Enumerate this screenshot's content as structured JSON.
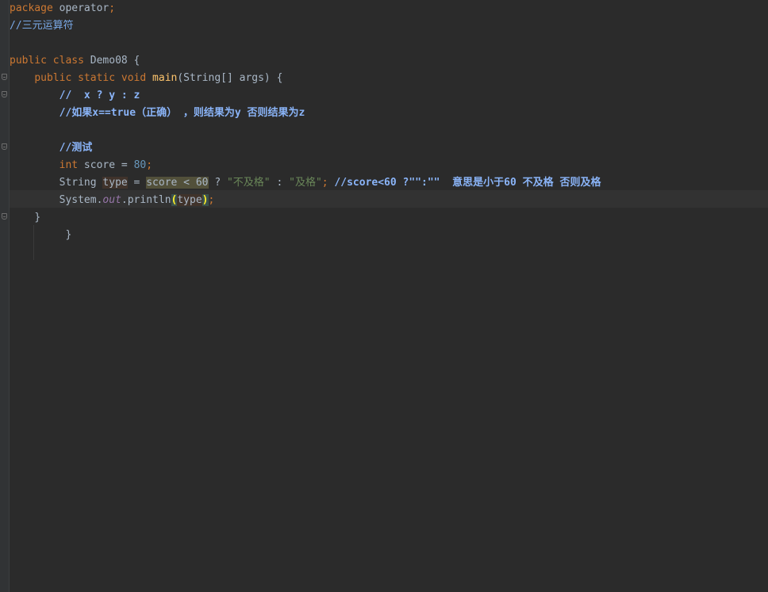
{
  "editor": {
    "lines": {
      "l1": {
        "kw": "package",
        "rest": " operator",
        "semi": ";"
      },
      "l2": {
        "comment": "//三元运算符"
      },
      "l4": {
        "kw1": "public",
        "kw2": "class",
        "name": " Demo08 {"
      },
      "l5": {
        "kw1": "public",
        "kw2": "static",
        "kw3": "void",
        "fn": "main",
        "rest": "(String[] args) {"
      },
      "l6": {
        "comment": "//  x ? y : z"
      },
      "l7": {
        "comment": "//如果x==true（正确） ，则结果为y 否则结果为z"
      },
      "l9": {
        "comment": "//测试"
      },
      "l10": {
        "kw": "int",
        "rest1": " score = ",
        "num": "80",
        "semi": ";"
      },
      "l11": {
        "t1": "String ",
        "var": "type",
        "t2": " = ",
        "cond": "score < 60",
        "t3": " ? ",
        "s1": "\"不及格\"",
        "t4": " : ",
        "s2": "\"及格\"",
        "semi": ";",
        "comment": " //score<60 ?\"\":\"\"  意思是小于60 不及格 否则及格"
      },
      "l12": {
        "cls": "System.",
        "field": "out",
        "call": ".println",
        "lp": "(",
        "arg": "type",
        "rp": ")",
        "semi": ";"
      },
      "l13": {
        "text": "}"
      },
      "l14": {
        "text": "}"
      }
    }
  }
}
